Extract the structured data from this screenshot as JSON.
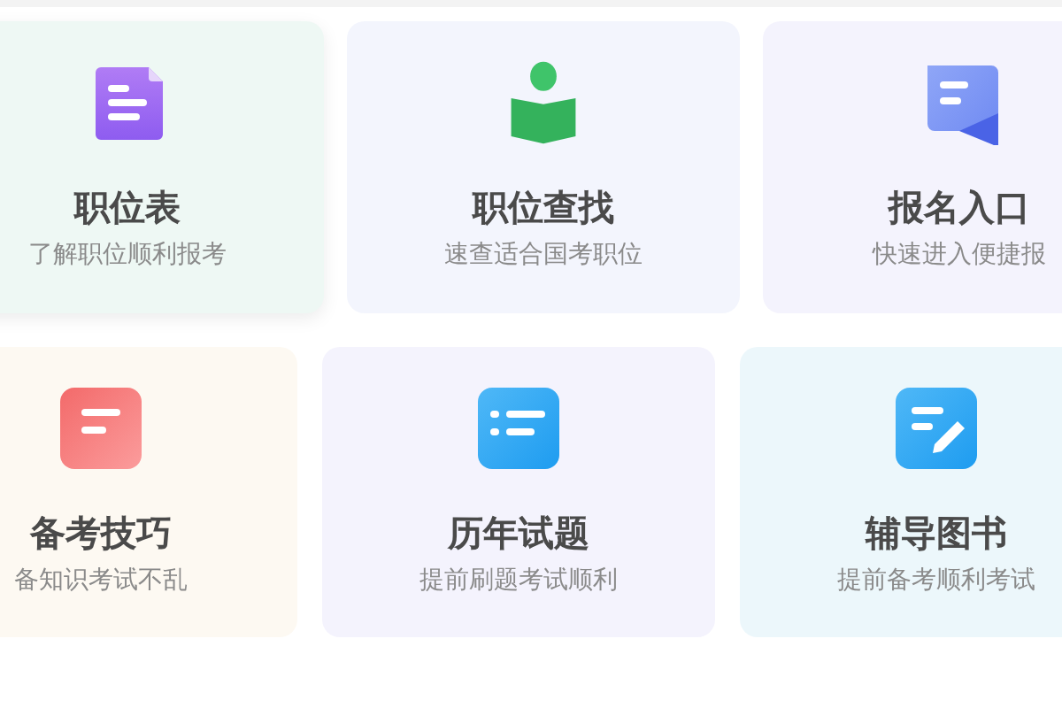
{
  "rows": [
    {
      "cards": [
        {
          "title": "职位表",
          "subtitle": "了解职位顺利报考",
          "kind": "document",
          "color": "#eef8f4"
        },
        {
          "title": "职位查找",
          "subtitle": "速查适合国考职位",
          "kind": "reader",
          "color": "#f3f5fd"
        },
        {
          "title": "报名入口",
          "subtitle": "快速进入便捷报",
          "kind": "bookmark",
          "color": "#f4f3fd"
        }
      ]
    },
    {
      "cards": [
        {
          "title": "备考技巧",
          "subtitle": "备知识考试不乱",
          "kind": "note",
          "color": "#fdf9f2"
        },
        {
          "title": "历年试题",
          "subtitle": "提前刷题考试顺利",
          "kind": "list",
          "color": "#f4f3fd"
        },
        {
          "title": "辅导图书",
          "subtitle": "提前备考顺利考试",
          "kind": "edit",
          "color": "#ecf7fb"
        }
      ]
    }
  ]
}
